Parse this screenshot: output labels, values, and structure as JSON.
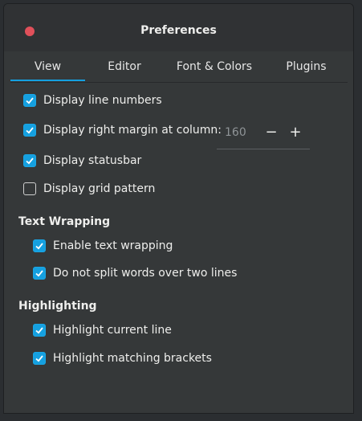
{
  "window": {
    "title": "Preferences"
  },
  "tabs": [
    {
      "label": "View",
      "active": true
    },
    {
      "label": "Editor",
      "active": false
    },
    {
      "label": "Font & Colors",
      "active": false
    },
    {
      "label": "Plugins",
      "active": false
    }
  ],
  "view": {
    "line_numbers": {
      "label": "Display line numbers",
      "checked": true
    },
    "right_margin": {
      "label": "Display right margin at column:",
      "checked": true,
      "value": "160",
      "minus": "−",
      "plus": "+"
    },
    "statusbar": {
      "label": "Display statusbar",
      "checked": true
    },
    "grid": {
      "label": "Display grid pattern",
      "checked": false
    }
  },
  "text_wrapping": {
    "heading": "Text Wrapping",
    "enable": {
      "label": "Enable text wrapping",
      "checked": true
    },
    "no_split": {
      "label": "Do not split words over two lines",
      "checked": true
    }
  },
  "highlighting": {
    "heading": "Highlighting",
    "current_line": {
      "label": "Highlight current line",
      "checked": true
    },
    "brackets": {
      "label": "Highlight matching brackets",
      "checked": true
    }
  },
  "colors": {
    "accent": "#15a0e0",
    "close": "#e0505a",
    "background": "#353839"
  }
}
